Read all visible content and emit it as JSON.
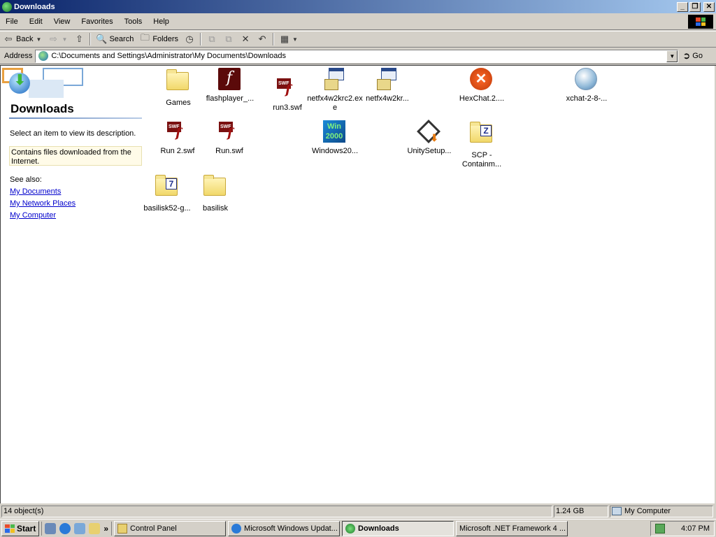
{
  "window": {
    "title": "Downloads",
    "buttons": {
      "minimize": "_",
      "maximize": "❐",
      "close": "✕"
    }
  },
  "menu": [
    "File",
    "Edit",
    "View",
    "Favorites",
    "Tools",
    "Help"
  ],
  "toolbar": {
    "back": "Back",
    "search": "Search",
    "folders": "Folders"
  },
  "address": {
    "label": "Address",
    "path": "C:\\Documents and Settings\\Administrator\\My Documents\\Downloads",
    "go": "Go"
  },
  "leftpane": {
    "heading": "Downloads",
    "select_hint": "Select an item to view its description.",
    "description": "Contains files downloaded from the Internet.",
    "see_also": "See also:",
    "links": [
      "My Documents",
      "My Network Places",
      "My Computer"
    ]
  },
  "files": [
    {
      "name": "Games",
      "type": "folder"
    },
    {
      "name": "flashplayer_...",
      "type": "flash"
    },
    {
      "name": "run3.swf",
      "type": "swf"
    },
    {
      "name": "netfx4w2krc2.exe",
      "type": "installer"
    },
    {
      "name": "netfx4w2kr...",
      "type": "installer"
    },
    {
      "name": "HexChat.2....",
      "type": "hexchat"
    },
    {
      "name": "xchat-2-8-...",
      "type": "xchat"
    },
    {
      "name": "Run 2.swf",
      "type": "swf"
    },
    {
      "name": "Run.swf",
      "type": "swf"
    },
    {
      "name": "Windows20...",
      "type": "win2k"
    },
    {
      "name": "UnitySetup...",
      "type": "unity"
    },
    {
      "name": "SCP - Containm...",
      "type": "zipfolder"
    },
    {
      "name": "basilisk52-g...",
      "type": "7zfolder"
    },
    {
      "name": "basilisk",
      "type": "folder"
    }
  ],
  "status": {
    "objects": "14 object(s)",
    "size": "1.24 GB",
    "location": "My Computer"
  },
  "taskbar": {
    "start": "Start",
    "tasks": [
      {
        "label": "Control Panel",
        "active": false
      },
      {
        "label": "Microsoft Windows Updat...",
        "active": false
      },
      {
        "label": "Downloads",
        "active": true
      },
      {
        "label": "Microsoft .NET Framework 4 ...",
        "active": false
      }
    ],
    "clock": "4:07 PM"
  },
  "colors": {
    "titlebar_start": "#0a246a",
    "titlebar_end": "#a6caf0",
    "link": "#0000cc",
    "face": "#d4d0c8"
  }
}
